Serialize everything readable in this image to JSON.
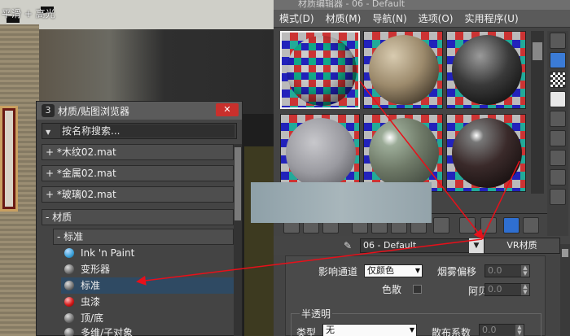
{
  "viewport": {
    "label": "平滑 + 高光"
  },
  "editor": {
    "title": "材质编辑器 - 06 - Default",
    "menu": [
      "模式(D)",
      "材质(M)",
      "导航(N)",
      "选项(O)",
      "实用程序(U)"
    ],
    "material_name": "06 - Default",
    "material_type": "VR材质",
    "params": {
      "affect_channel_label": "影响通道",
      "affect_channel_value": "仅颜色",
      "fog_offset_label": "烟雾偏移",
      "fog_offset_value": "0.0",
      "dispersion_label": "色散",
      "abbe_label": "阿贝",
      "abbe_value": "0.0",
      "translucency_section": "半透明",
      "type_label": "类型",
      "type_value": "无",
      "scatter_label": "散布系数",
      "scatter_value": "0.0"
    }
  },
  "browser": {
    "title": "材质/贴图浏览器",
    "close_label": "✕",
    "search_placeholder": "按名称搜索...",
    "libraries": [
      "+ *木纹02.mat",
      "+ *金属02.mat",
      "+ *玻璃02.mat"
    ],
    "category": "- 材质",
    "subcategory": "- 标准",
    "materials": [
      {
        "label": "Ink 'n Paint",
        "icon": "cyan"
      },
      {
        "label": "变形器",
        "icon": "gray"
      },
      {
        "label": "标准",
        "icon": "gray"
      },
      {
        "label": "虫漆",
        "icon": "red"
      },
      {
        "label": "顶/底",
        "icon": "gray"
      },
      {
        "label": "多维/子对象",
        "icon": "gray"
      }
    ]
  },
  "colors": {
    "arrow": "#e8101a",
    "selected_row": "#2f4a63"
  }
}
